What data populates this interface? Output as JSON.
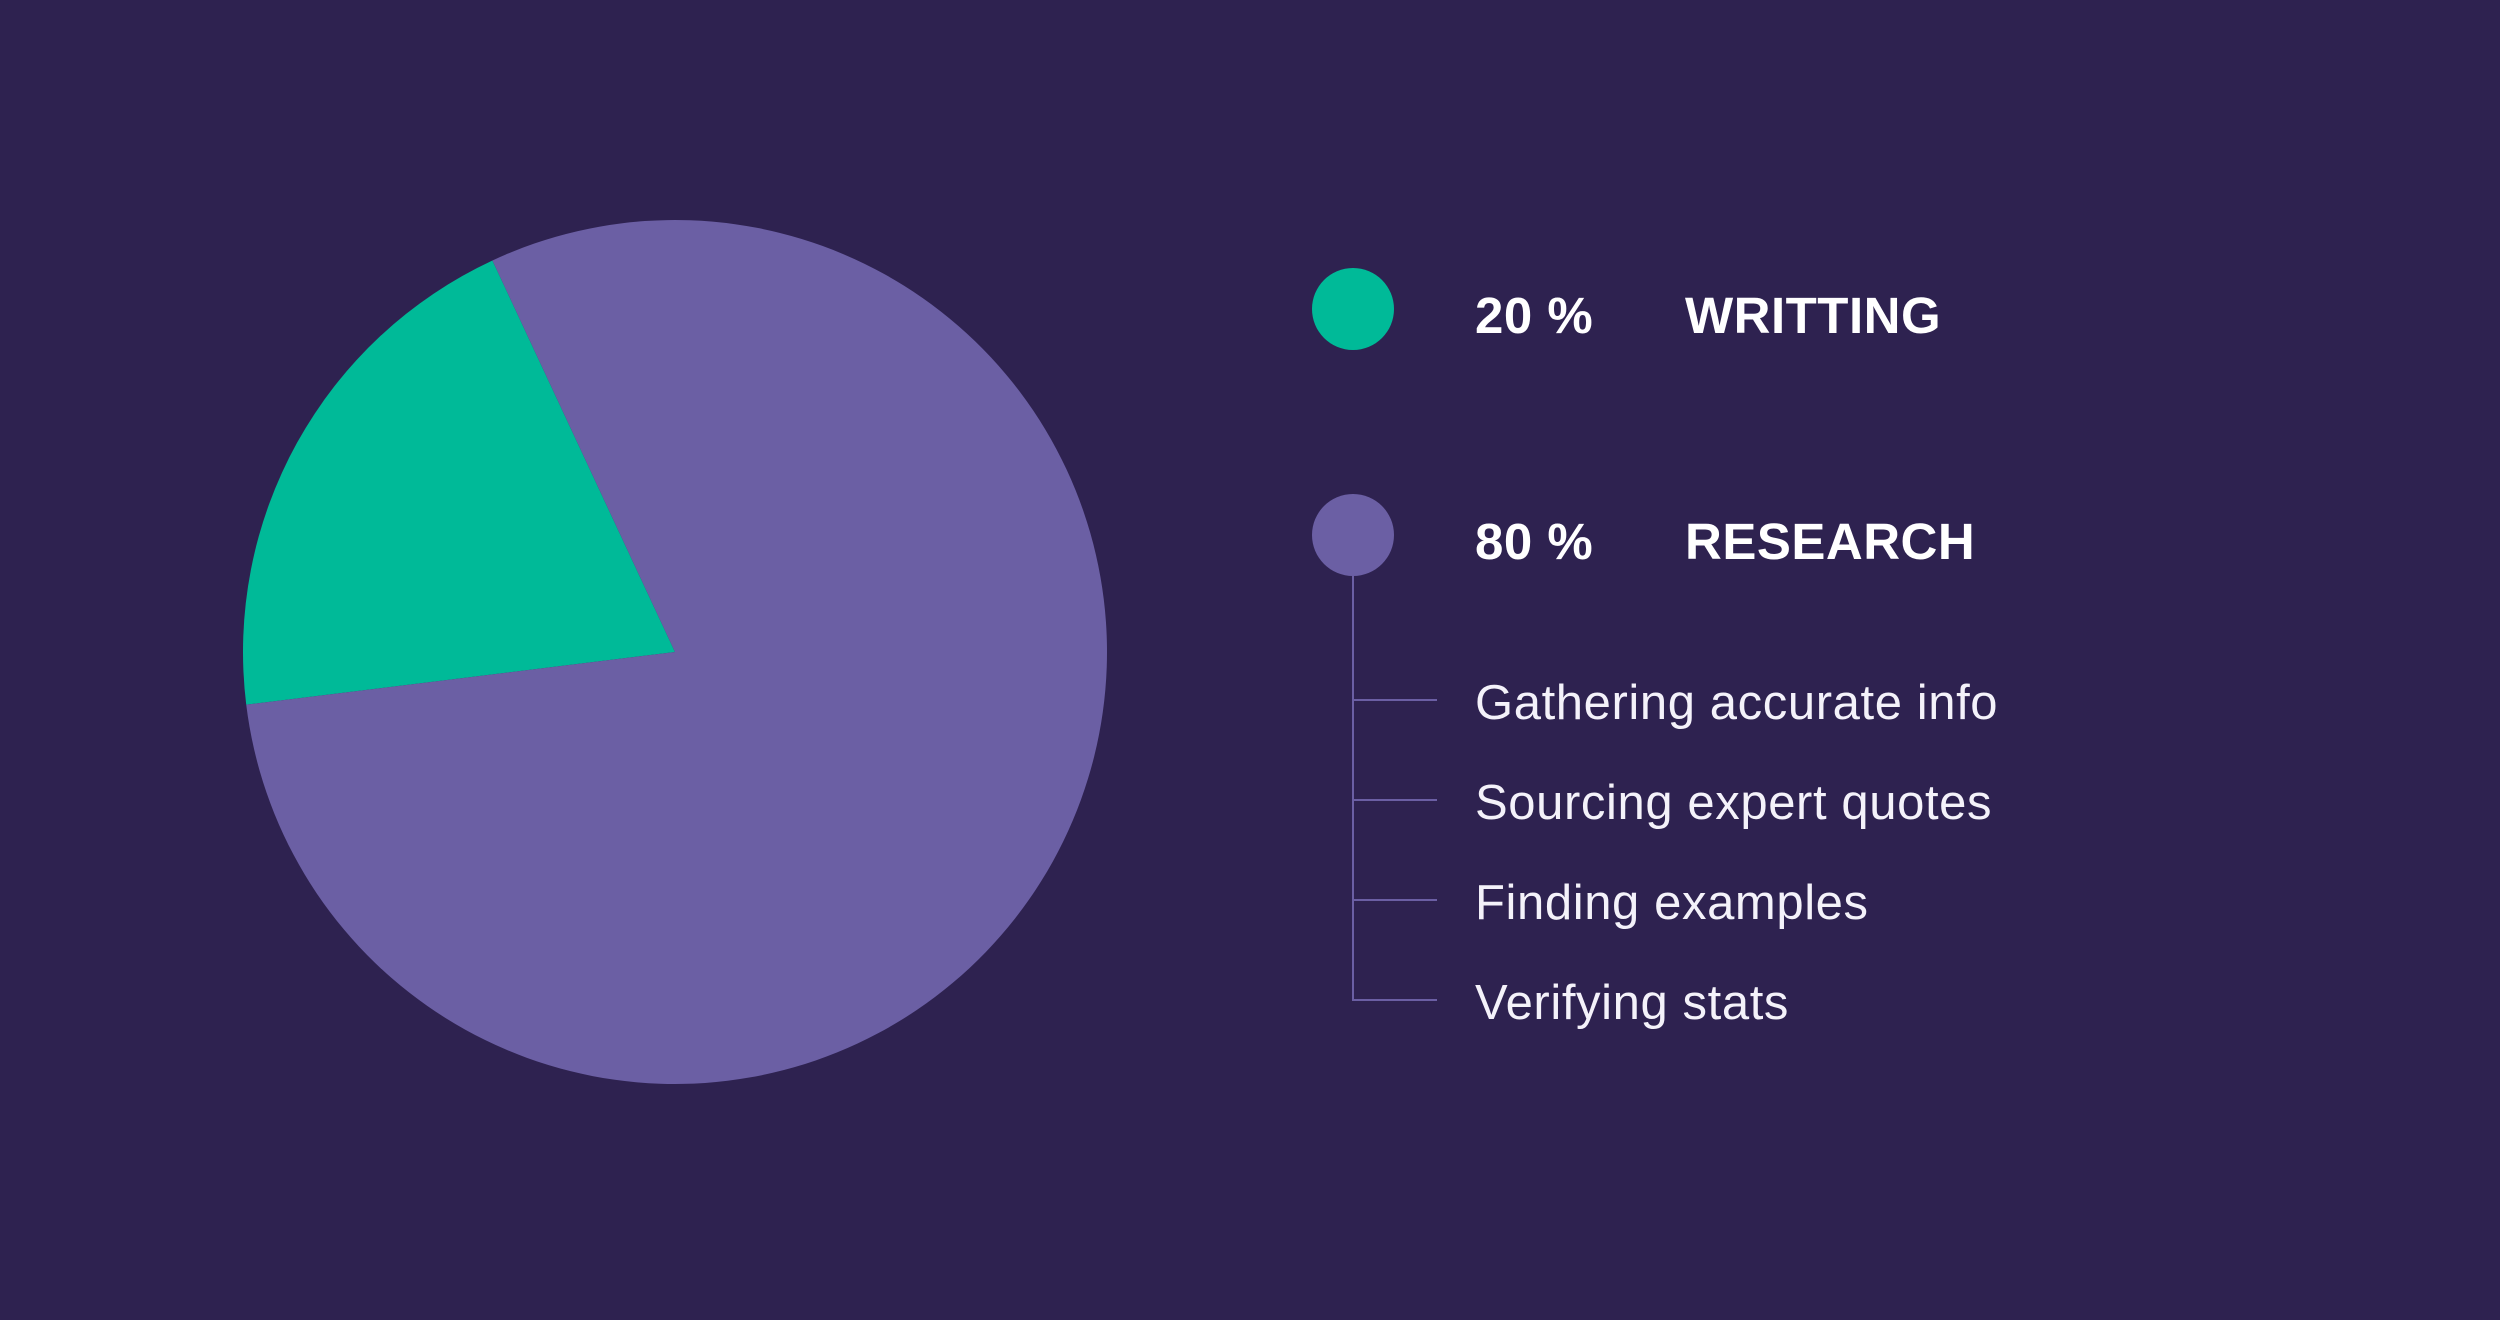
{
  "colors": {
    "background": "#2E2250",
    "writing": "#00BA98",
    "research": "#6B5FA4",
    "text": "#FFFFFF"
  },
  "chart_data": {
    "type": "pie",
    "title": "",
    "start_angle_deg": -25,
    "direction": "counterclockwise",
    "slices": [
      {
        "name": "WRITTING",
        "value": 20,
        "unit": "%",
        "color": "#00BA98"
      },
      {
        "name": "RESEARCH",
        "value": 80,
        "unit": "%",
        "color": "#6B5FA4"
      }
    ],
    "legend": {
      "placement": "right",
      "entries": [
        {
          "pct_label": "20 %",
          "label": "WRITTING",
          "color": "#00BA98"
        },
        {
          "pct_label": "80 %",
          "label": "RESEARCH",
          "color": "#6B5FA4",
          "sub_items": [
            "Gathering accurate info",
            "Sourcing expert quotes",
            "Finding examples",
            "Verifying stats"
          ]
        }
      ]
    }
  }
}
